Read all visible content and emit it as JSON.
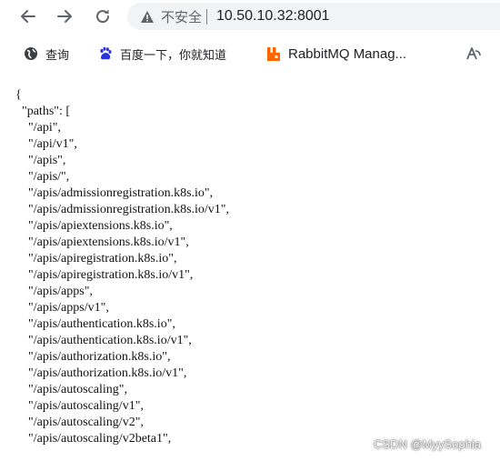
{
  "toolbar": {
    "back_icon": "arrow-left-icon",
    "forward_icon": "arrow-right-icon",
    "reload_icon": "reload-icon",
    "security_icon": "warning-triangle-icon",
    "security_label": "不安全",
    "url": "10.50.10.32:8001"
  },
  "bookmarks": [
    {
      "icon": "globe-icon",
      "label": "查询"
    },
    {
      "icon": "baidu-paw-icon",
      "label": "百度一下，你就知道"
    },
    {
      "icon": "rabbitmq-icon",
      "label": "RabbitMQ Manag..."
    },
    {
      "icon": "translate-icon",
      "label": ""
    }
  ],
  "json_lines": [
    "{",
    "  \"paths\": [",
    "    \"/api\",",
    "    \"/api/v1\",",
    "    \"/apis\",",
    "    \"/apis/\",",
    "    \"/apis/admissionregistration.k8s.io\",",
    "    \"/apis/admissionregistration.k8s.io/v1\",",
    "    \"/apis/apiextensions.k8s.io\",",
    "    \"/apis/apiextensions.k8s.io/v1\",",
    "    \"/apis/apiregistration.k8s.io\",",
    "    \"/apis/apiregistration.k8s.io/v1\",",
    "    \"/apis/apps\",",
    "    \"/apis/apps/v1\",",
    "    \"/apis/authentication.k8s.io\",",
    "    \"/apis/authentication.k8s.io/v1\",",
    "    \"/apis/authorization.k8s.io\",",
    "    \"/apis/authorization.k8s.io/v1\",",
    "    \"/apis/autoscaling\",",
    "    \"/apis/autoscaling/v1\",",
    "    \"/apis/autoscaling/v2\",",
    "    \"/apis/autoscaling/v2beta1\","
  ],
  "watermark": "CSDN @MyySophia",
  "colors": {
    "omnibox_bg": "#f1f3f4",
    "text": "#202124",
    "muted": "#5f6368",
    "rabbit_orange": "#ff6600",
    "baidu_blue": "#2932e1"
  }
}
